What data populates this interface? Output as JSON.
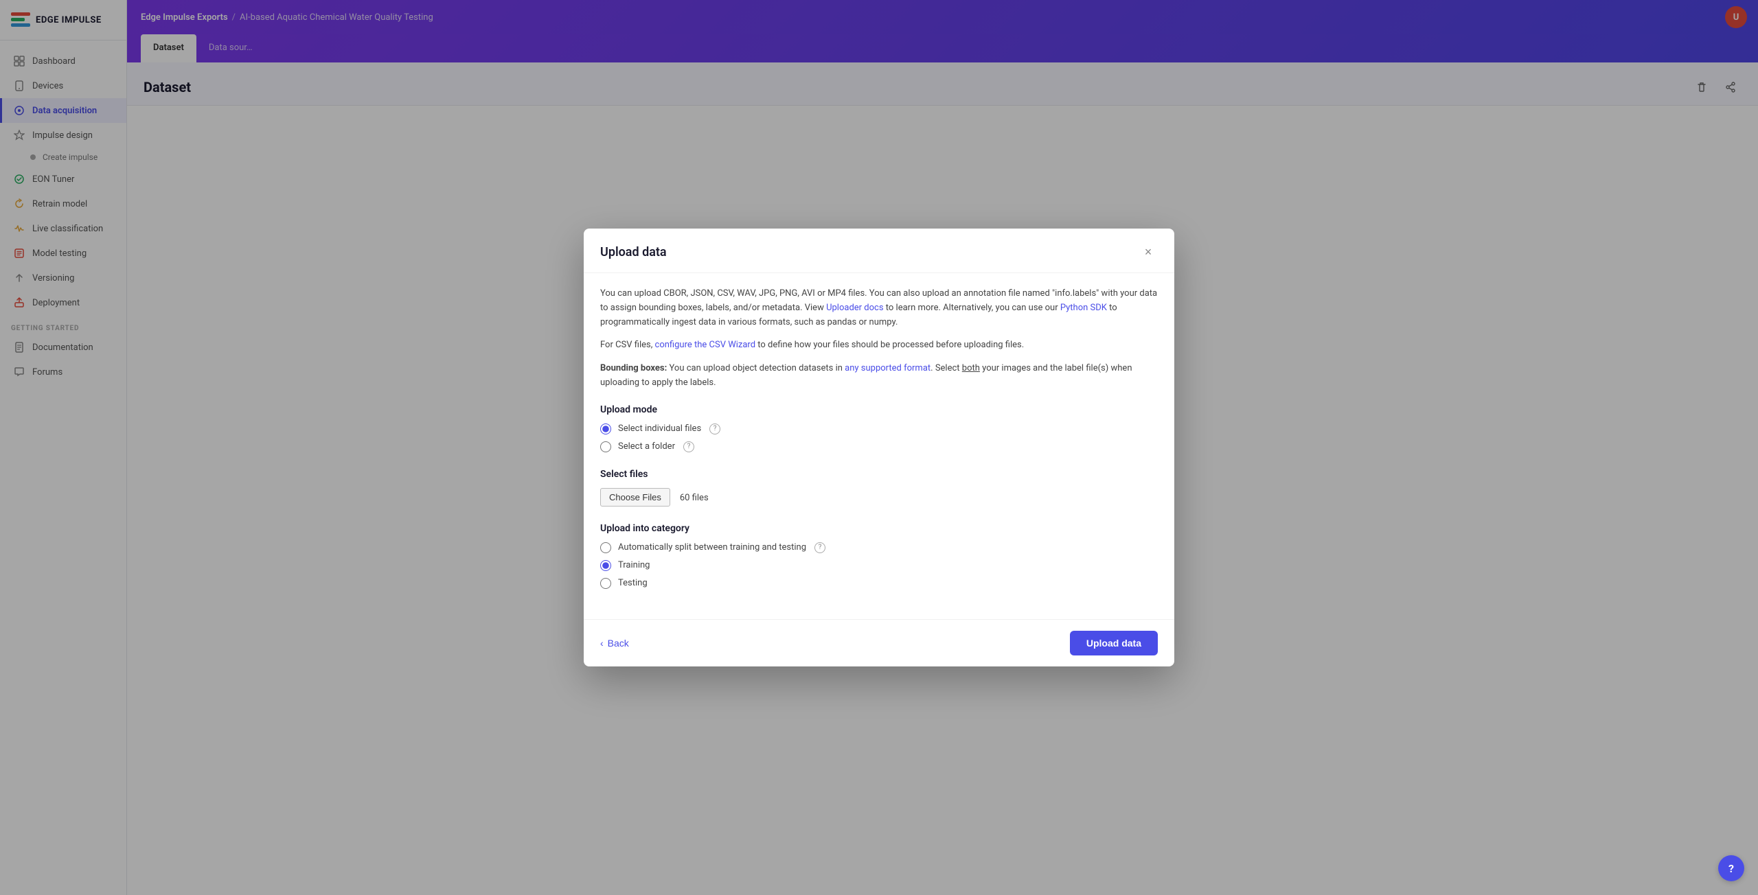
{
  "brand": {
    "name": "EDGE IMPULSE",
    "logo_bars": [
      "#e74c3c",
      "#27ae60",
      "#3498db"
    ]
  },
  "topbar": {
    "title": "Edge Impulse Exports",
    "separator": "/",
    "subtitle": "AI-based Aquatic Chemical Water Quality Testing",
    "avatar_initials": "U"
  },
  "sidebar": {
    "items": [
      {
        "id": "dashboard",
        "label": "Dashboard",
        "icon": "⬜"
      },
      {
        "id": "devices",
        "label": "Devices",
        "icon": "📱"
      },
      {
        "id": "data-acquisition",
        "label": "Data acquisition",
        "icon": "●",
        "active": true
      },
      {
        "id": "impulse-design",
        "label": "Impulse design",
        "icon": "⚡"
      },
      {
        "id": "create-impulse",
        "label": "Create impulse",
        "sub": true
      },
      {
        "id": "eon-tuner",
        "label": "EON Tuner",
        "icon": "✓"
      },
      {
        "id": "retrain-model",
        "label": "Retrain model",
        "icon": "✱"
      },
      {
        "id": "live-classification",
        "label": "Live classification",
        "icon": "✱"
      },
      {
        "id": "model-testing",
        "label": "Model testing",
        "icon": "☐"
      },
      {
        "id": "versioning",
        "label": "Versioning",
        "icon": "↑"
      },
      {
        "id": "deployment",
        "label": "Deployment",
        "icon": "🎁"
      }
    ],
    "getting_started_label": "GETTING STARTED",
    "getting_started_items": [
      {
        "id": "documentation",
        "label": "Documentation",
        "icon": "📄"
      },
      {
        "id": "forums",
        "label": "Forums",
        "icon": "💬"
      }
    ]
  },
  "tabs": [
    {
      "id": "dataset",
      "label": "Dataset",
      "active": true
    },
    {
      "id": "data-sources",
      "label": "Data sour…"
    }
  ],
  "dataset_header": "Dataset",
  "modal": {
    "title": "Upload data",
    "close_label": "×",
    "info_text": "You can upload CBOR, JSON, CSV, WAV, JPG, PNG, AVI or MP4 files. You can also upload an annotation file named \"info.labels\" with your data to assign bounding boxes, labels, and/or metadata. View ",
    "uploader_docs_link": "Uploader docs",
    "info_text_mid": " to learn more. Alternatively, you can use our ",
    "python_sdk_link": "Python SDK",
    "info_text_end": " to programmatically ingest data in various formats, such as pandas or numpy.",
    "csv_note_pre": "For CSV files, ",
    "csv_wizard_link": "configure the CSV Wizard",
    "csv_note_end": " to define how your files should be processed before uploading files.",
    "bbox_label": "Bounding boxes:",
    "bbox_text_pre": " You can upload object detection datasets in ",
    "bbox_link": "any supported format",
    "bbox_text_end": ". Select ",
    "bbox_underline": "both",
    "bbox_text_final": " your images and the label file(s) when uploading to apply the labels.",
    "upload_mode_label": "Upload mode",
    "radio_individual": "Select individual files",
    "radio_folder": "Select a folder",
    "select_files_label": "Select files",
    "choose_files_btn": "Choose Files",
    "file_count": "60 files",
    "upload_into_category_label": "Upload into category",
    "radio_auto_split": "Automatically split between training and testing",
    "radio_training": "Training",
    "radio_testing": "Testing",
    "back_label": "Back",
    "upload_btn_label": "Upload data"
  },
  "help": {
    "label": "?"
  }
}
